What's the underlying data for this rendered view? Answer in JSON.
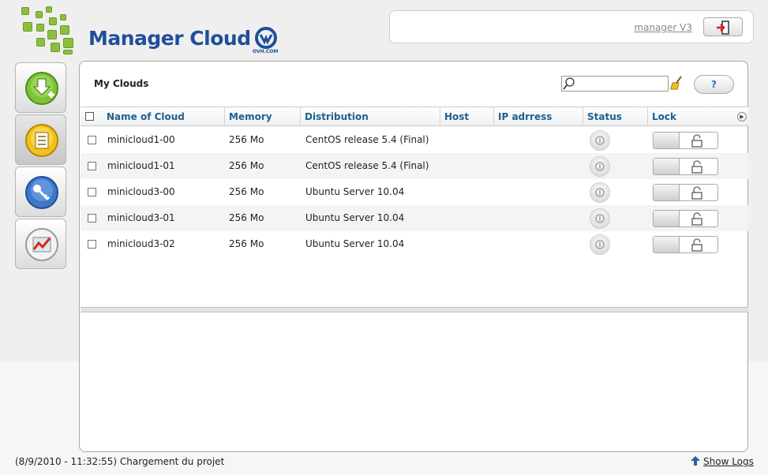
{
  "header": {
    "brand": "Manager Cloud",
    "ovh_label": "OVH.COM",
    "manager_link": "manager V3"
  },
  "sidebar": {
    "items": [
      {
        "name": "download-add",
        "icon": "download-add-icon"
      },
      {
        "name": "list",
        "icon": "list-icon",
        "active": true
      },
      {
        "name": "key",
        "icon": "key-icon"
      },
      {
        "name": "stats",
        "icon": "chart-icon"
      }
    ]
  },
  "main": {
    "title": "My Clouds",
    "search": {
      "value": "",
      "placeholder": ""
    },
    "help_label": "?"
  },
  "table": {
    "columns": [
      "Name of Cloud",
      "Memory",
      "Distribution",
      "Host",
      "IP adrress",
      "Status",
      "Lock"
    ],
    "rows": [
      {
        "name": "minicloud1-00",
        "memory": "256 Mo",
        "distribution": "CentOS release 5.4 (Final)",
        "host": "",
        "ip": ""
      },
      {
        "name": "minicloud1-01",
        "memory": "256 Mo",
        "distribution": "CentOS release 5.4 (Final)",
        "host": "",
        "ip": ""
      },
      {
        "name": "minicloud3-00",
        "memory": "256 Mo",
        "distribution": "Ubuntu Server 10.04",
        "host": "",
        "ip": ""
      },
      {
        "name": "minicloud3-01",
        "memory": "256 Mo",
        "distribution": "Ubuntu Server 10.04",
        "host": "",
        "ip": ""
      },
      {
        "name": "minicloud3-02",
        "memory": "256 Mo",
        "distribution": "Ubuntu Server 10.04",
        "host": "",
        "ip": ""
      }
    ]
  },
  "footer": {
    "status": "(8/9/2010 - 11:32:55) Chargement du projet",
    "show_logs": "Show Logs"
  },
  "colors": {
    "brand_blue": "#1f4f9a",
    "header_text": "#1f5f8f",
    "logo_green": "#8cbf3f"
  }
}
